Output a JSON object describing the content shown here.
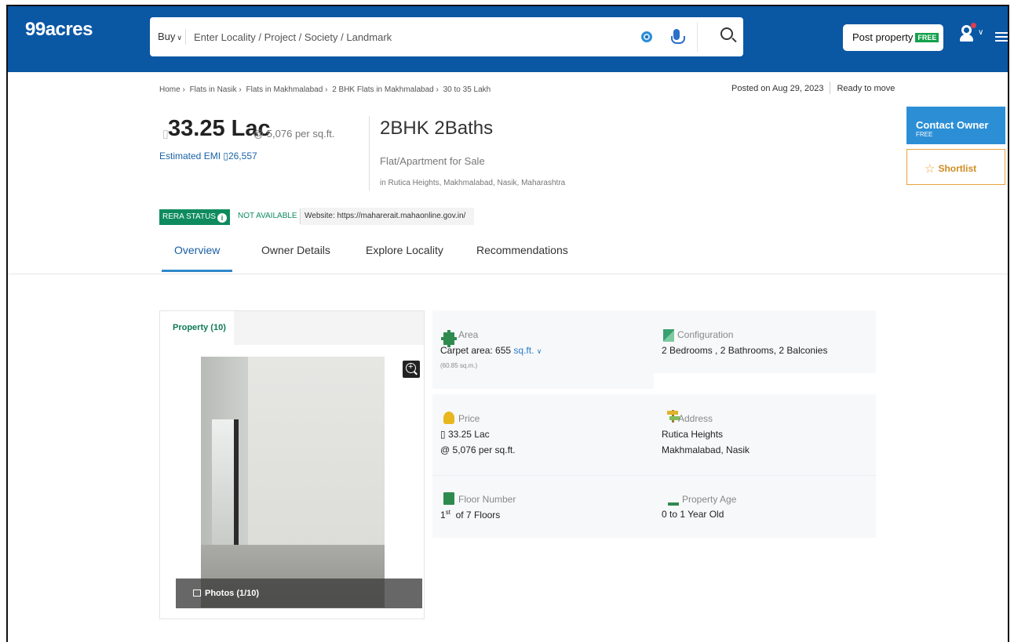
{
  "header": {
    "logo": "99acres",
    "buy_label": "Buy",
    "search_placeholder": "Enter Locality / Project / Society / Landmark",
    "post_property_label": "Post property",
    "post_property_badge": "FREE",
    "brand_color": "#0a57a4"
  },
  "breadcrumb": [
    "Home ›",
    "Flats in Nasik ›",
    "Flats in Makhmalabad ›",
    "2 BHK Flats in Makhmalabad ›",
    "30 to 35 Lakh"
  ],
  "listing": {
    "posted_on": "Posted on Aug 29, 2023",
    "status": "Ready to move",
    "price": "33.25 Lac",
    "price_per_sqft": "@ 5,076 per sq.ft.",
    "emi": "Estimated EMI ▯26,557",
    "config_title": "2BHK 2Baths",
    "property_type": "Flat/Apartment for Sale",
    "location": "in Rutica Heights, Makhmalabad, Nasik, Maharashtra",
    "rera_label": "RERA STATUS",
    "rera_status": "NOT AVAILABLE",
    "rera_website": "Website: https://maharerait.mahaonline.gov.in/"
  },
  "tabs": [
    "Overview",
    "Owner Details",
    "Explore Locality",
    "Recommendations"
  ],
  "actions": {
    "contact_owner": "Contact Owner",
    "contact_badge": "FREE",
    "shortlist": "Shortlist"
  },
  "gallery": {
    "tab_label": "Property (10)",
    "photos_label": "Photos (1/10)"
  },
  "details": {
    "area": {
      "label": "Area",
      "value": "Carpet area: 655",
      "unit": "sq.ft.",
      "sub": "(60.85 sq.m.)"
    },
    "configuration": {
      "label": "Configuration",
      "value": "2 Bedrooms , 2 Bathrooms, 2 Balconies"
    },
    "price": {
      "label": "Price",
      "value": "▯ 33.25 Lac",
      "sub": "@ 5,076 per sq.ft."
    },
    "address": {
      "label": "Address",
      "line1": "Rutica Heights",
      "line2": "Makhmalabad, Nasik"
    },
    "floor": {
      "label": "Floor Number",
      "value_sup": "st",
      "value_num": "1",
      "value_rest": "of 7 Floors"
    },
    "age": {
      "label": "Property Age",
      "value": "0 to 1 Year Old"
    }
  }
}
